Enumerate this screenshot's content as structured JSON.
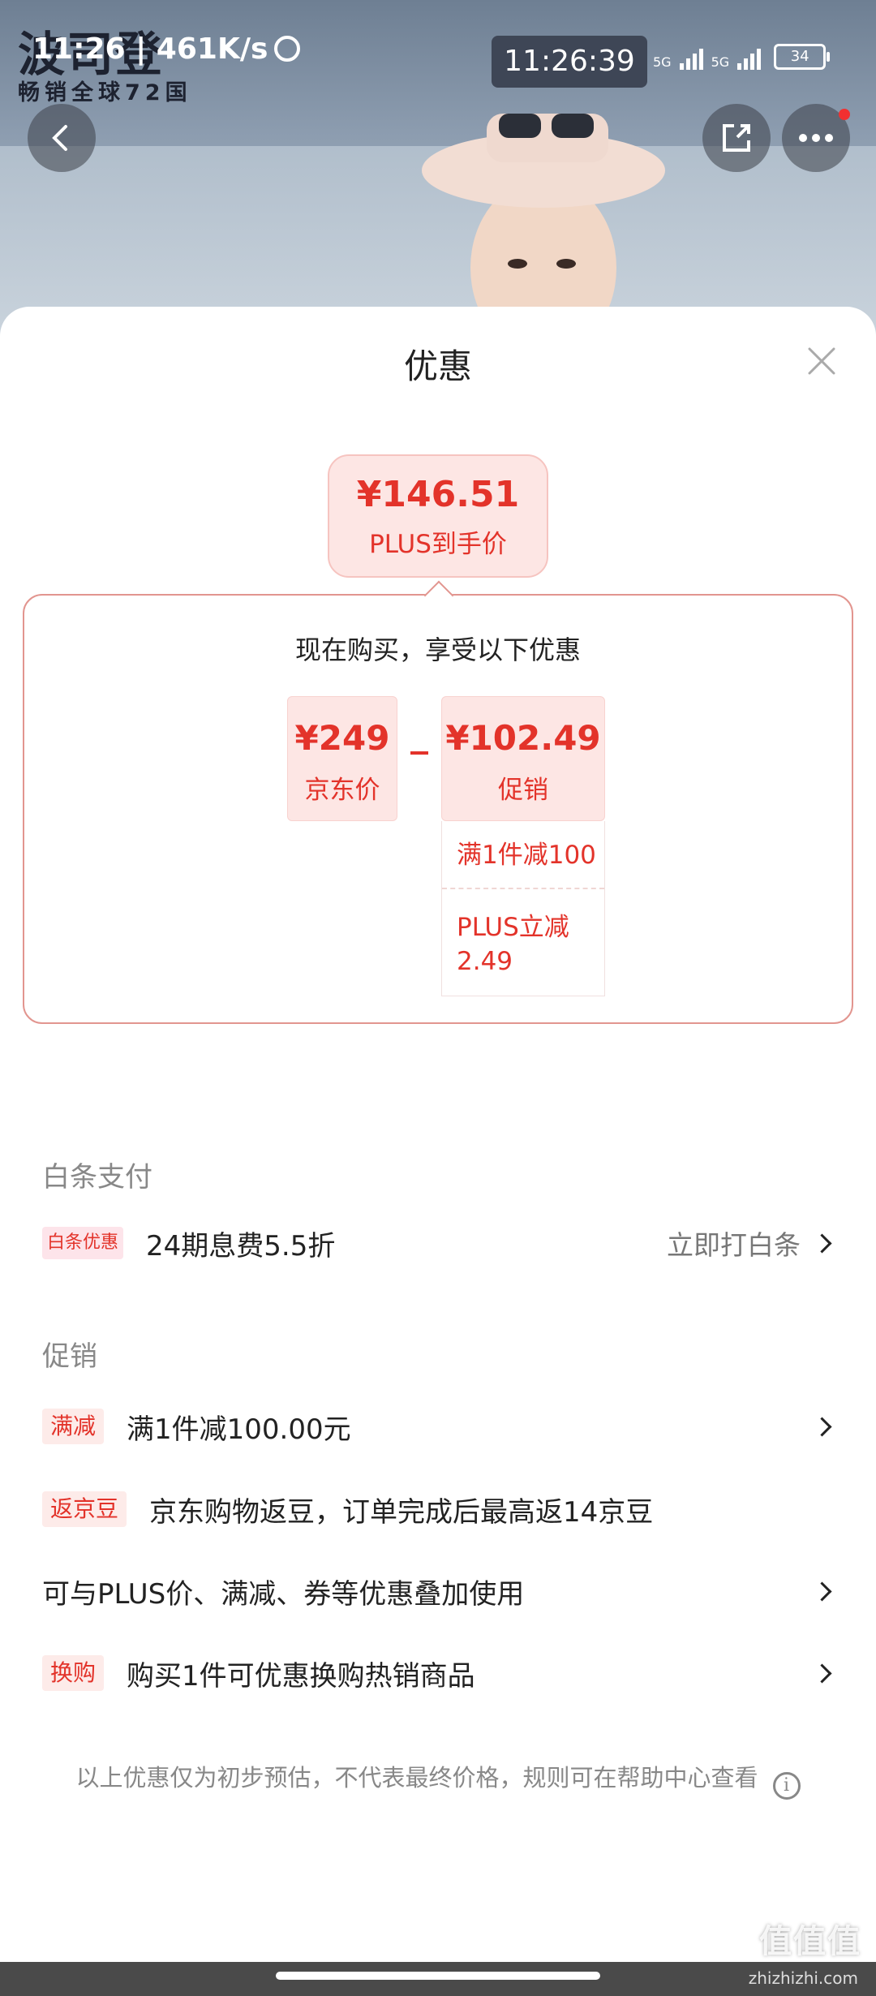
{
  "status_bar": {
    "left": "11:26 | 461K/s",
    "time": "11:26:39",
    "network1": "5G",
    "network2": "5G",
    "battery": "34"
  },
  "hero": {
    "brand": "波司登",
    "tagline": "畅销全球72国"
  },
  "sheet": {
    "title": "优惠"
  },
  "final_price": {
    "amount": "¥146.51",
    "label": "PLUS到手价"
  },
  "calc": {
    "headline": "现在购买，享受以下优惠",
    "jd_price": {
      "amount": "¥249",
      "label": "京东价"
    },
    "promo_price": {
      "amount": "¥102.49",
      "label": "促销"
    },
    "promo_items": [
      "满1件减100",
      "PLUS立减\n2.49"
    ]
  },
  "baitiao": {
    "section_title": "白条支付",
    "tag": "白条优惠",
    "text": "24期息费5.5折",
    "action": "立即打白条"
  },
  "promotions": {
    "section_title": "促销",
    "items": [
      {
        "tag": "满减",
        "text": "满1件减100.00元"
      },
      {
        "tag": "返京豆",
        "text": "京东购物返豆，订单完成后最高返14京豆"
      },
      {
        "tag": "",
        "text": "可与PLUS价、满减、券等优惠叠加使用"
      },
      {
        "tag": "换购",
        "text": "购买1件可优惠换购热销商品"
      }
    ]
  },
  "disclaimer": "以上优惠仅为初步预估，不代表最终价格，规则可在帮助中心查看",
  "watermark": {
    "main": "值值值",
    "sub": "zhizhizhi.com"
  }
}
